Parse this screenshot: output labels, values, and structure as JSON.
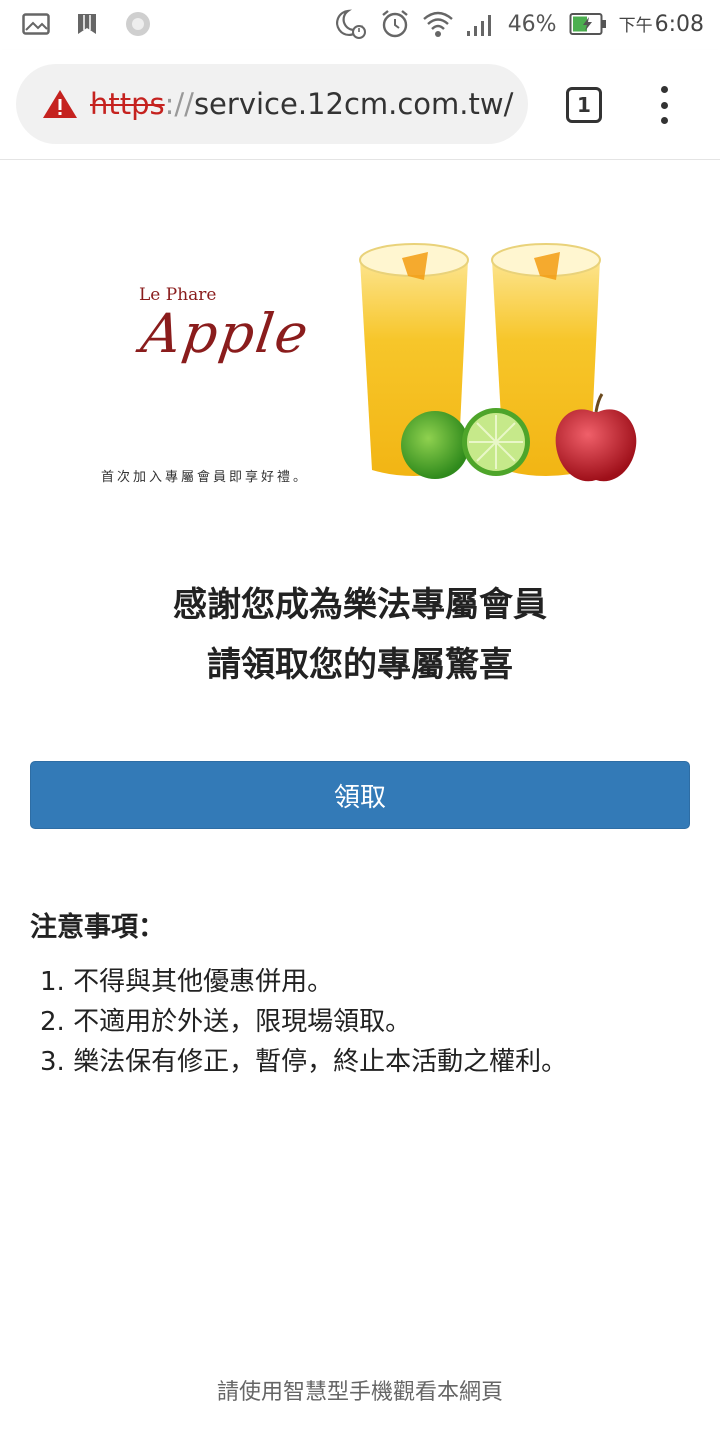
{
  "status_bar": {
    "battery": "46%",
    "time_prefix": "下午",
    "time": "6:08",
    "icons": [
      "image-icon",
      "bookmark-icon",
      "loading-icon",
      "moon-alarm-icon",
      "alarm-icon",
      "wifi-icon",
      "signal-icon",
      "battery-icon"
    ]
  },
  "browser": {
    "url_scheme": "https",
    "url_sep": "://",
    "url_rest": "service.12cm.com.tw/",
    "tab_count": "1",
    "warning_color": "#c5221f"
  },
  "banner": {
    "brand_small": "Le Phare",
    "brand_big": "Apple",
    "tagline": "首次加入專屬會員即享好禮。",
    "brand_color": "#8a1c1c"
  },
  "headline": {
    "line1": "感謝您成為樂法專屬會員",
    "line2": "請領取您的專屬驚喜"
  },
  "claim_button": {
    "label": "領取",
    "color": "#337ab7"
  },
  "notes": {
    "title": "注意事項：",
    "items": [
      "1. 不得與其他優惠併用。",
      "2. 不適用於外送，限現場領取。",
      "3. 樂法保有修正，暫停，終止本活動之權利。"
    ]
  },
  "footer": {
    "text": "請使用智慧型手機觀看本網頁"
  }
}
